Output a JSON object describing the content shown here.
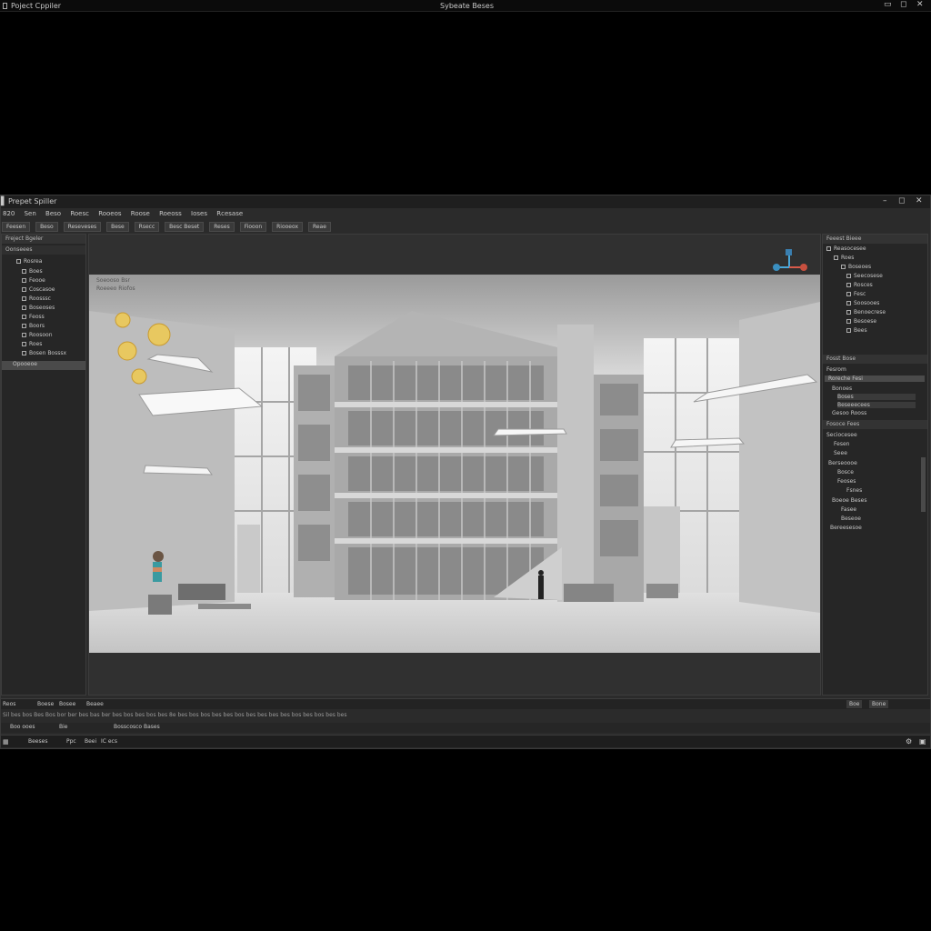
{
  "window": {
    "left_title": "Poject Cppiler",
    "center_title": "Sybeate Beses"
  },
  "app": {
    "title": "Prepet Spiller",
    "menu": [
      "820",
      "Sen",
      "Beso",
      "Roesc",
      "Rooeos",
      "Roose",
      "Roeoss",
      "Ioses",
      "Rcesase"
    ],
    "toolbar": [
      "Feesen",
      "Beso",
      "Reseveses",
      "Bese",
      "Rsecc",
      "Besc Beset",
      "Reses",
      "Fiooon",
      "Riooeox",
      "Reae"
    ]
  },
  "left_panel": {
    "title": "Freject Bgeler",
    "sub": "Oonseees",
    "items": [
      "Rosrea",
      "Boes",
      "Feooe",
      "Coscasoe",
      "Roosssc",
      "Boseoses",
      "Feoss",
      "Boors",
      "Roosoon",
      "Roes",
      "Bosen Bosssx"
    ],
    "footer": "Opooeoe"
  },
  "viewport": {
    "labels": [
      "Soeooso Bsr",
      "Roeeeo Riofos"
    ]
  },
  "right_panel": {
    "title": "Feeest Bieee",
    "outline": [
      "Reasocesee",
      "Roes",
      "Boseoes",
      "Seecosese",
      "Rosces",
      "Fesc",
      "Soosooes",
      "Benoecrese",
      "Besoese",
      "Bees"
    ],
    "props_title": "Fosst Bose",
    "props_tab": "Fesrom",
    "props_sel": "Roreche Fesi",
    "props_rows": [
      "Bonoes",
      "Boses",
      "Beseeecees",
      "Gesoo Rooss"
    ],
    "details_title": "Fosoce Fees",
    "details_rows": [
      "Seciocesee",
      "Fesen",
      "Seee",
      "Berseoooe",
      "Bosce",
      "Feoses",
      "Fsnes",
      "Boeoe Beses",
      "Fasee",
      "Beseoe",
      "Bereesesoe"
    ]
  },
  "bottom": {
    "tabs": [
      "Reos",
      "Boese",
      "Bosee",
      "Beaee"
    ],
    "right_buttons": [
      "Boe",
      "Bone"
    ],
    "console": "Sil bes bos Bes Bos bor ber bes bas ber bes bos bes bos bes 8e bes bos bos bes bes bos bes bes bes bes bos bes bos bes bes",
    "row2": [
      "Boo ooes",
      "Bie",
      "Bosscosco Bases"
    ],
    "status": [
      "Beeses",
      "Ppc",
      "Beei",
      "IC ecs"
    ]
  }
}
